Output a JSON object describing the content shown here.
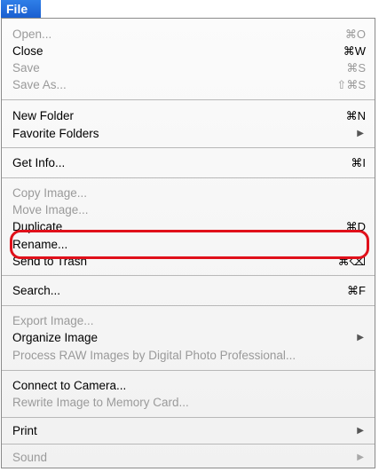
{
  "menubar": {
    "title": "File"
  },
  "menu": {
    "items": [
      {
        "label": "Open...",
        "shortcut": "⌘O",
        "disabled": true
      },
      {
        "label": "Close",
        "shortcut": "⌘W",
        "disabled": false
      },
      {
        "label": "Save",
        "shortcut": "⌘S",
        "disabled": true
      },
      {
        "label": "Save As...",
        "shortcut": "⇧⌘S",
        "disabled": true
      },
      {
        "label": "New Folder",
        "shortcut": "⌘N",
        "disabled": false
      },
      {
        "label": "Favorite Folders",
        "submenu": true,
        "disabled": false
      },
      {
        "label": "Get Info...",
        "shortcut": "⌘I",
        "disabled": false
      },
      {
        "label": "Copy Image...",
        "disabled": true
      },
      {
        "label": "Move Image...",
        "disabled": true
      },
      {
        "label": "Duplicate",
        "shortcut": "⌘D",
        "disabled": false
      },
      {
        "label": "Rename...",
        "disabled": false,
        "highlighted": true
      },
      {
        "label": "Send to Trash",
        "shortcut": "⌘⌫",
        "disabled": false
      },
      {
        "label": "Search...",
        "shortcut": "⌘F",
        "disabled": false
      },
      {
        "label": "Export Image...",
        "disabled": true
      },
      {
        "label": "Organize Image",
        "submenu": true,
        "disabled": false
      },
      {
        "label": "Process RAW Images by Digital Photo Professional...",
        "disabled": true
      },
      {
        "label": "Connect to Camera...",
        "disabled": false
      },
      {
        "label": "Rewrite Image to Memory Card...",
        "disabled": true
      },
      {
        "label": "Print",
        "submenu": true,
        "disabled": false
      },
      {
        "label": "Sound",
        "submenu": true,
        "disabled": true
      }
    ],
    "highlight_color": "#e0101a"
  }
}
